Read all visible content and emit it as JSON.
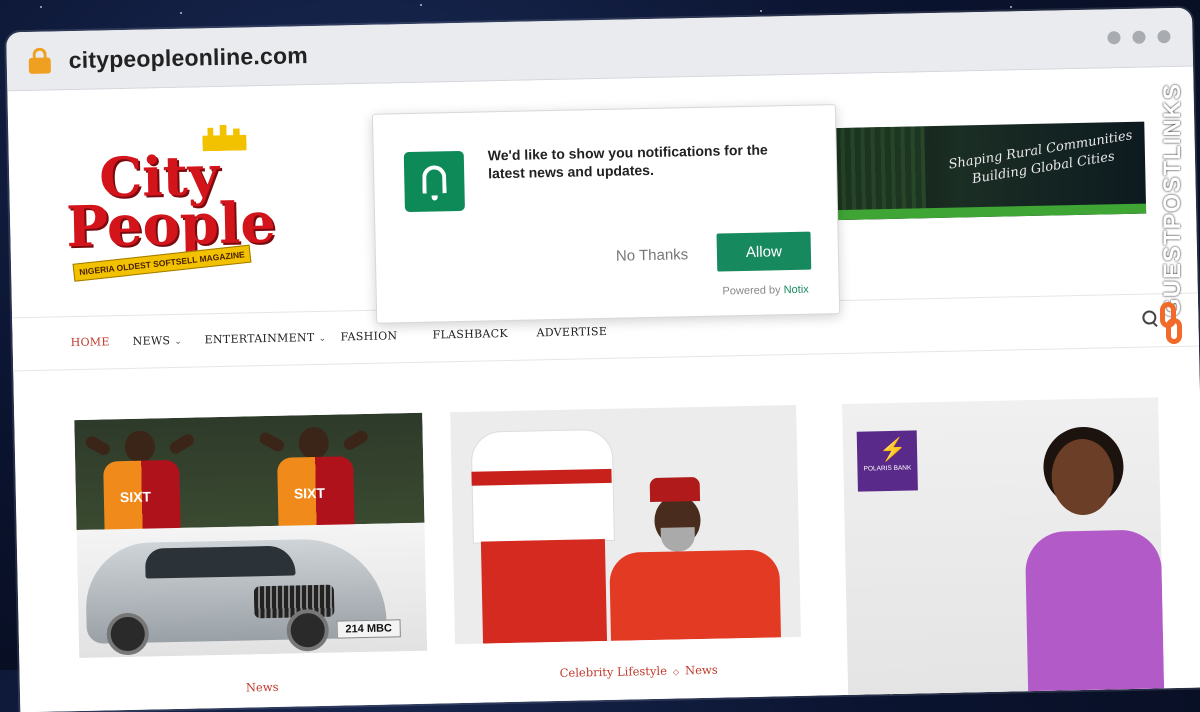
{
  "browser": {
    "url": "citypeopleonline.com"
  },
  "logo": {
    "line1": "City",
    "line2": "People",
    "tagline": "NIGERIA OLDEST SOFTSELL MAGAZINE"
  },
  "banner": {
    "text": "Shaping Rural Communities Building Global Cities"
  },
  "nav": {
    "items": [
      {
        "label": "HOME",
        "active": true
      },
      {
        "label": "NEWS",
        "dropdown": true
      },
      {
        "label": "ENTERTAINMENT",
        "dropdown": true
      },
      {
        "label": "FASHION"
      },
      {
        "label": "FLASHBACK"
      },
      {
        "label": "ADVERTISE"
      }
    ],
    "search_icon": "search-icon"
  },
  "popup": {
    "message": "We'd like to show you notifications for the latest news and updates.",
    "no_label": "No Thanks",
    "allow_label": "Allow",
    "powered_prefix": "Powered by",
    "powered_brand": "Notix",
    "icon": "bell-icon",
    "accent": "#168a5e"
  },
  "cards": [
    {
      "category": "News",
      "plate": "214 MBC",
      "sponsor": "SIXT"
    },
    {
      "categories": [
        "Celebrity Lifestyle",
        "News"
      ]
    },
    {
      "ad_brand": "POLARIS BANK"
    }
  ],
  "watermark": {
    "text": "GUESTPOSTLINKS"
  }
}
